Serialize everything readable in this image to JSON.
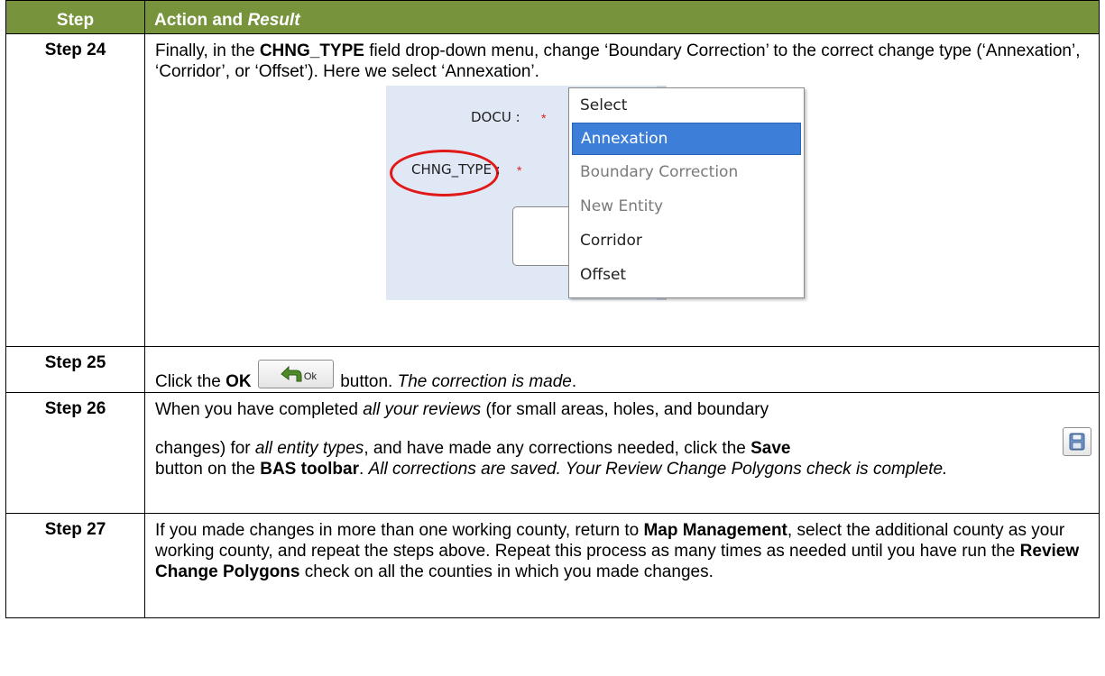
{
  "header": {
    "col1": "Step",
    "col2_prefix": "Action and ",
    "col2_italic": "Result"
  },
  "step24": {
    "step": "Step 24",
    "t1": "Finally, in the ",
    "b1": "CHNG_TYPE",
    "t2": " field drop-down menu, change ‘Boundary Correction’ to the correct change type (‘Annexation’, ‘Corridor’, or ‘Offset’). Here we select ‘Annexation’.",
    "shot": {
      "docu_label": "DOCU :",
      "chng_label": "CHNG_TYPE :",
      "star": "*",
      "options": [
        "Select",
        "Annexation",
        "Boundary Correction",
        "New Entity",
        "Corridor",
        "Offset"
      ],
      "selected": "Annexation"
    }
  },
  "step25": {
    "step": "Step 25",
    "t1": "Click the ",
    "b1": "OK",
    "btn_label": "Ok",
    "t2": " button. ",
    "i1": "The correction is made",
    "t3": "."
  },
  "step26": {
    "step": "Step 26",
    "t1": "When you have completed ",
    "i1": "all your reviews",
    "t2": " (for small areas, holes, and boundary",
    "t3": "changes) for ",
    "i2": "all entity types",
    "t4": ", and have made any corrections needed, click the ",
    "b1": "Save",
    "t5": "button on the ",
    "b2": "BAS toolbar",
    "t6": ". ",
    "i3": "All corrections are saved. Your Review Change Polygons check is complete."
  },
  "step27": {
    "step": "Step 27",
    "t1": "If you made changes in more than one working county, return to ",
    "b1": "Map Management",
    "t2": ", select the additional county as your working county, and repeat the steps above. Repeat this process as many times as needed until you have run the ",
    "b2": "Review Change Polygons",
    "t3": " check on all the counties in which you made changes."
  },
  "colors": {
    "header_bg": "#77933c",
    "selected_item": "#3d7fd8",
    "ellipse": "#e01818"
  }
}
